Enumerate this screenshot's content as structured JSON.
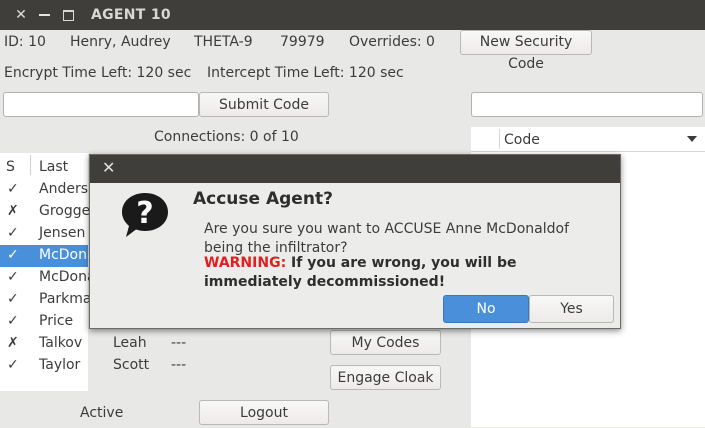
{
  "window": {
    "title": "AGENT 10"
  },
  "info": {
    "id": "ID: 10",
    "name": "Henry, Audrey",
    "code": "THETA-9",
    "number": "79979",
    "overrides": "Overrides: 0",
    "new_code_button": "New Security Code",
    "encrypt": "Encrypt Time Left: 120 sec",
    "intercept": "Intercept Time Left: 120 sec",
    "submit_button": "Submit Code",
    "connections": "Connections: 0 of 10"
  },
  "table": {
    "headers": [
      "S",
      "Last"
    ],
    "rows": [
      {
        "status": "✓",
        "last": "Anders",
        "first": "",
        "code": ""
      },
      {
        "status": "✗",
        "last": "Grogge",
        "first": "",
        "code": ""
      },
      {
        "status": "✓",
        "last": "Jensen",
        "first": "",
        "code": ""
      },
      {
        "status": "✓",
        "last": "McDona",
        "first": "",
        "code": ""
      },
      {
        "status": "✓",
        "last": "McDona",
        "first": "",
        "code": ""
      },
      {
        "status": "✓",
        "last": "Parkma",
        "first": "",
        "code": ""
      },
      {
        "status": "✓",
        "last": "Price",
        "first": "",
        "code": ""
      },
      {
        "status": "✗",
        "last": "Talkov",
        "first": "Leah",
        "code": "---"
      },
      {
        "status": "✓",
        "last": "Taylor",
        "first": "Scott",
        "code": "---"
      }
    ]
  },
  "actions": {
    "my_codes": "My Codes",
    "engage_cloak": "Engage Cloak",
    "status": "Active",
    "logout": "Logout"
  },
  "right": {
    "column_header": "Code"
  },
  "dialog": {
    "title": "Accuse Agent?",
    "message": "Are you sure you want to ACCUSE Anne McDonaldof being the infiltrator?",
    "warning_label": "WARNING:",
    "warning_text": " If you are wrong, you will be immediately decommissioned!",
    "no_button": "No",
    "yes_button": "Yes"
  },
  "colors": {
    "accent": "#4a8fd9",
    "titlebar": "#3f3e3a",
    "warning": "#e02020"
  }
}
